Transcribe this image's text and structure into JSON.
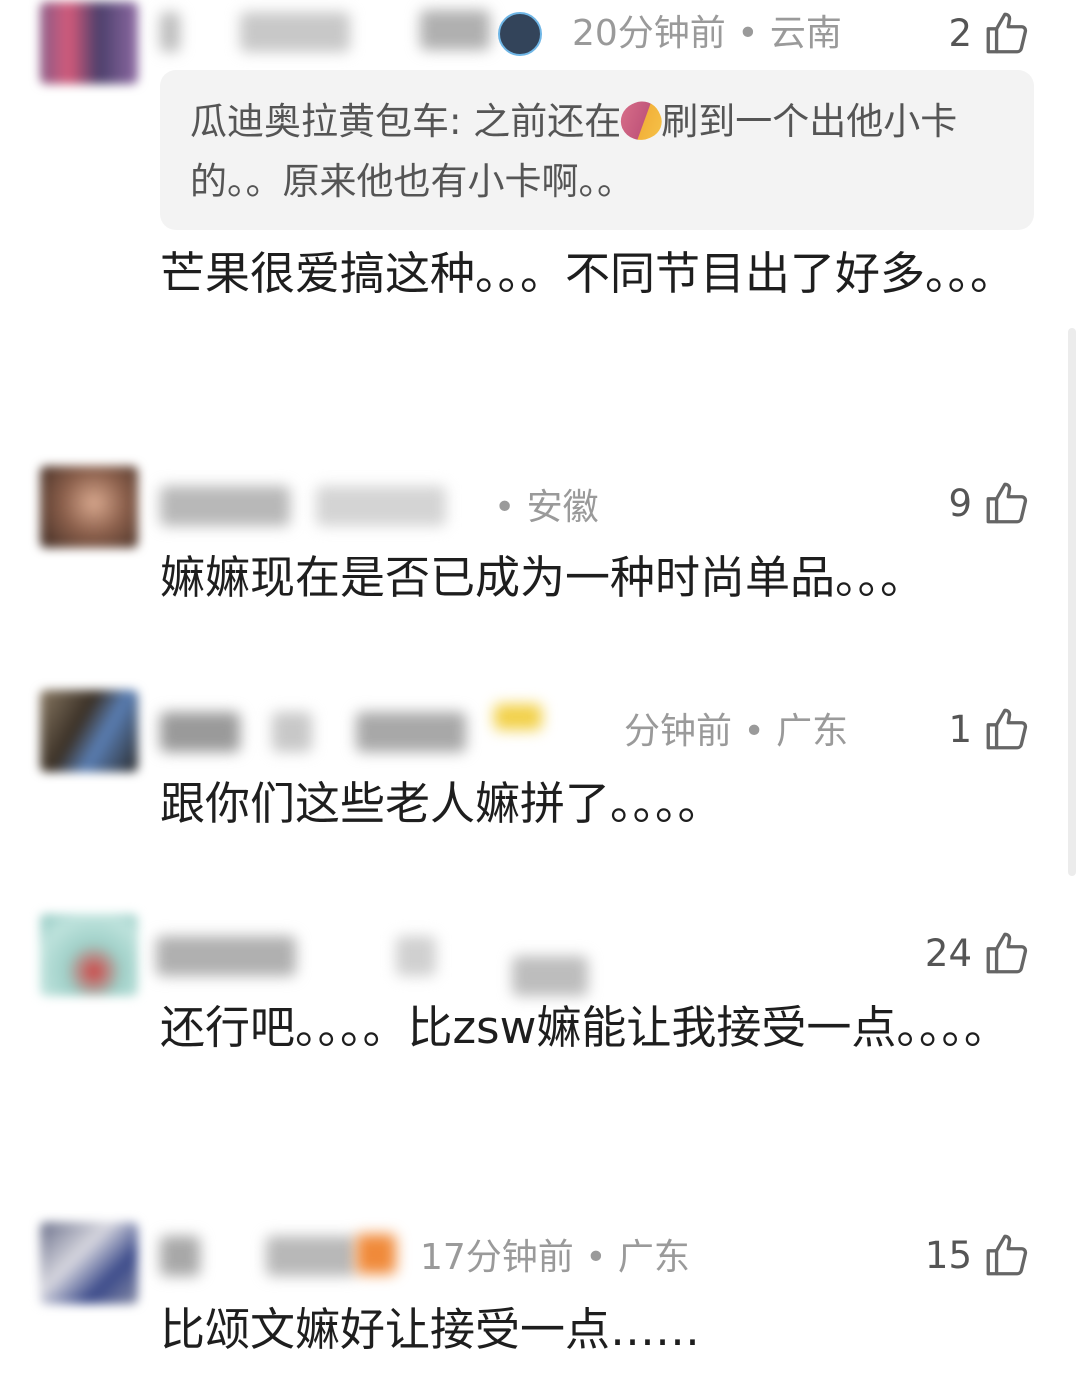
{
  "comments": [
    {
      "meta": "20分钟前 • 云南",
      "likes": "2",
      "quote": {
        "author_prefix": "瓜迪奥拉黄包车: 之前还在",
        "after_emoji": "刷到一个出他小卡的。。原来他也有小卡啊。。"
      },
      "text": "芒果很爱搞这种。。。不同节目出了好多。。。"
    },
    {
      "meta": "• 安徽",
      "likes": "9",
      "text": "嫲嫲现在是否已成为一种时尚单品。。。"
    },
    {
      "meta": "分钟前 • 广东",
      "likes": "1",
      "text": "跟你们这些老人嫲拼了。。。。"
    },
    {
      "meta": "",
      "likes": "24",
      "text": "还行吧。。。。比zsw嫲能让我接受一点。。。。"
    },
    {
      "meta": "17分钟前 • 广东",
      "likes": "15",
      "text": "比颂文嫲好让接受一点……"
    }
  ],
  "icons": {
    "like": "thumbs-up-icon",
    "badge": "penguin-badge-icon",
    "emoji": "sweet-potato-emoji"
  },
  "colors": {
    "meta": "#9a9a9a",
    "text": "#1e1e1e",
    "quote_bg": "#f3f3f3"
  }
}
